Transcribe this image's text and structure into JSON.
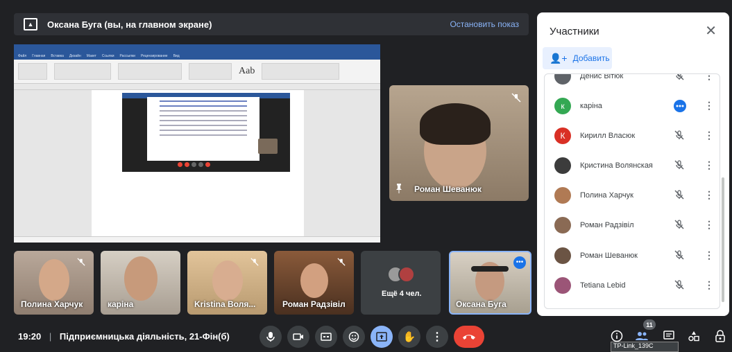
{
  "banner": {
    "text": "Оксана Буга (вы, на главном экране)",
    "stop_label": "Остановить показ",
    "icon": "present-to-all-icon"
  },
  "shared_screen": {
    "tabs": [
      "Файл",
      "Главная",
      "Вставка",
      "Дизайн",
      "Макет",
      "Ссылки",
      "Рассылки",
      "Рецензирование",
      "Вид"
    ],
    "ribbon_style_sample": "Aab"
  },
  "main_tile": {
    "name": "Роман Шеванюк",
    "pinned": true,
    "muted": true
  },
  "strip": [
    {
      "name": "Полина Харчук",
      "muted": true
    },
    {
      "name": "каріна",
      "muted": false
    },
    {
      "name": "Kristina Воля...",
      "muted": true
    },
    {
      "name": "Роман Радзівіл",
      "muted": true
    },
    {
      "name": "Ещё 4 чел.",
      "muted": false
    },
    {
      "name": "Оксана Буга",
      "muted": false
    }
  ],
  "panel": {
    "title": "Участники",
    "add_label": "Добавить",
    "participants": [
      {
        "name": "Денис Вітюк",
        "avatar_color": "#5f6368",
        "initial": "",
        "status": "muted"
      },
      {
        "name": "каріна",
        "avatar_color": "#34a853",
        "initial": "к",
        "status": "speaking"
      },
      {
        "name": "Кирилл Власюк",
        "avatar_color": "#d93025",
        "initial": "К",
        "status": "muted"
      },
      {
        "name": "Кристина Волянская",
        "avatar_color": "#3c3c3c",
        "initial": "",
        "status": "muted"
      },
      {
        "name": "Полина Харчук",
        "avatar_color": "#b07a54",
        "initial": "",
        "status": "muted"
      },
      {
        "name": "Роман Радзівіл",
        "avatar_color": "#8a6a54",
        "initial": "",
        "status": "muted"
      },
      {
        "name": "Роман Шеванюк",
        "avatar_color": "#6b5444",
        "initial": "",
        "status": "muted"
      },
      {
        "name": "Tetiana Lebid",
        "avatar_color": "#9b5577",
        "initial": "",
        "status": "muted"
      }
    ]
  },
  "bottom_bar": {
    "time": "19:20",
    "meeting_title": "Підприємницька діяльність, 21-Фін(б)",
    "participant_count": "11",
    "tooltip": "TP-Link_139C"
  },
  "colors": {
    "accent_blue": "#8ab4f8",
    "end_call_red": "#ea4335",
    "present_active": "#8ab4f8"
  }
}
